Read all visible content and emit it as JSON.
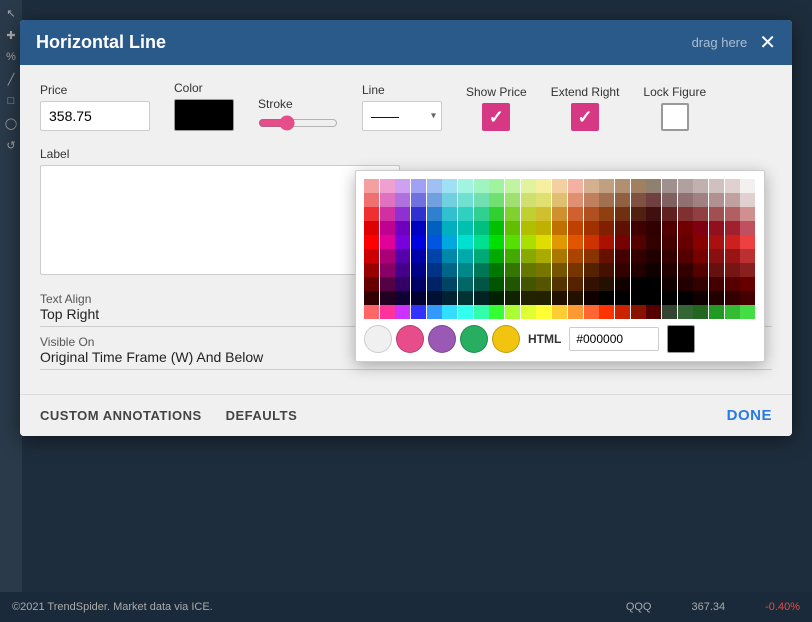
{
  "modal": {
    "title": "Horizontal Line",
    "drag_hint": "drag here",
    "price_label": "Price",
    "price_value": "358.75",
    "color_label": "Color",
    "stroke_label": "Stroke",
    "line_label": "Line",
    "show_price_label": "Show Price",
    "extend_right_label": "Extend Right",
    "lock_figure_label": "Lock Figure",
    "label_section_label": "Label",
    "text_align_label": "Text Align",
    "text_align_value": "Top Right",
    "visible_on_label": "Visible On",
    "visible_on_value": "Original Time Frame (W) And Below",
    "custom_annotations_btn": "CUSTOM ANNOTATIONS",
    "defaults_btn": "DEFAULTS",
    "done_btn": "DONE"
  },
  "color_picker": {
    "html_label": "HTML",
    "html_value": "#000000",
    "quick_colors": [
      "#f0f0f0",
      "#e74c8b",
      "#9b59b6",
      "#27ae60",
      "#f1c40f"
    ],
    "black_color": "#000000"
  },
  "status_bar": {
    "copyright": "©2021 TrendSpider. Market data via ICE.",
    "symbol": "QQQ",
    "price": "367.34",
    "change": "-0.40%"
  },
  "icons": {
    "close": "✕",
    "checkmark": "✓",
    "arrow_down": "▾"
  }
}
